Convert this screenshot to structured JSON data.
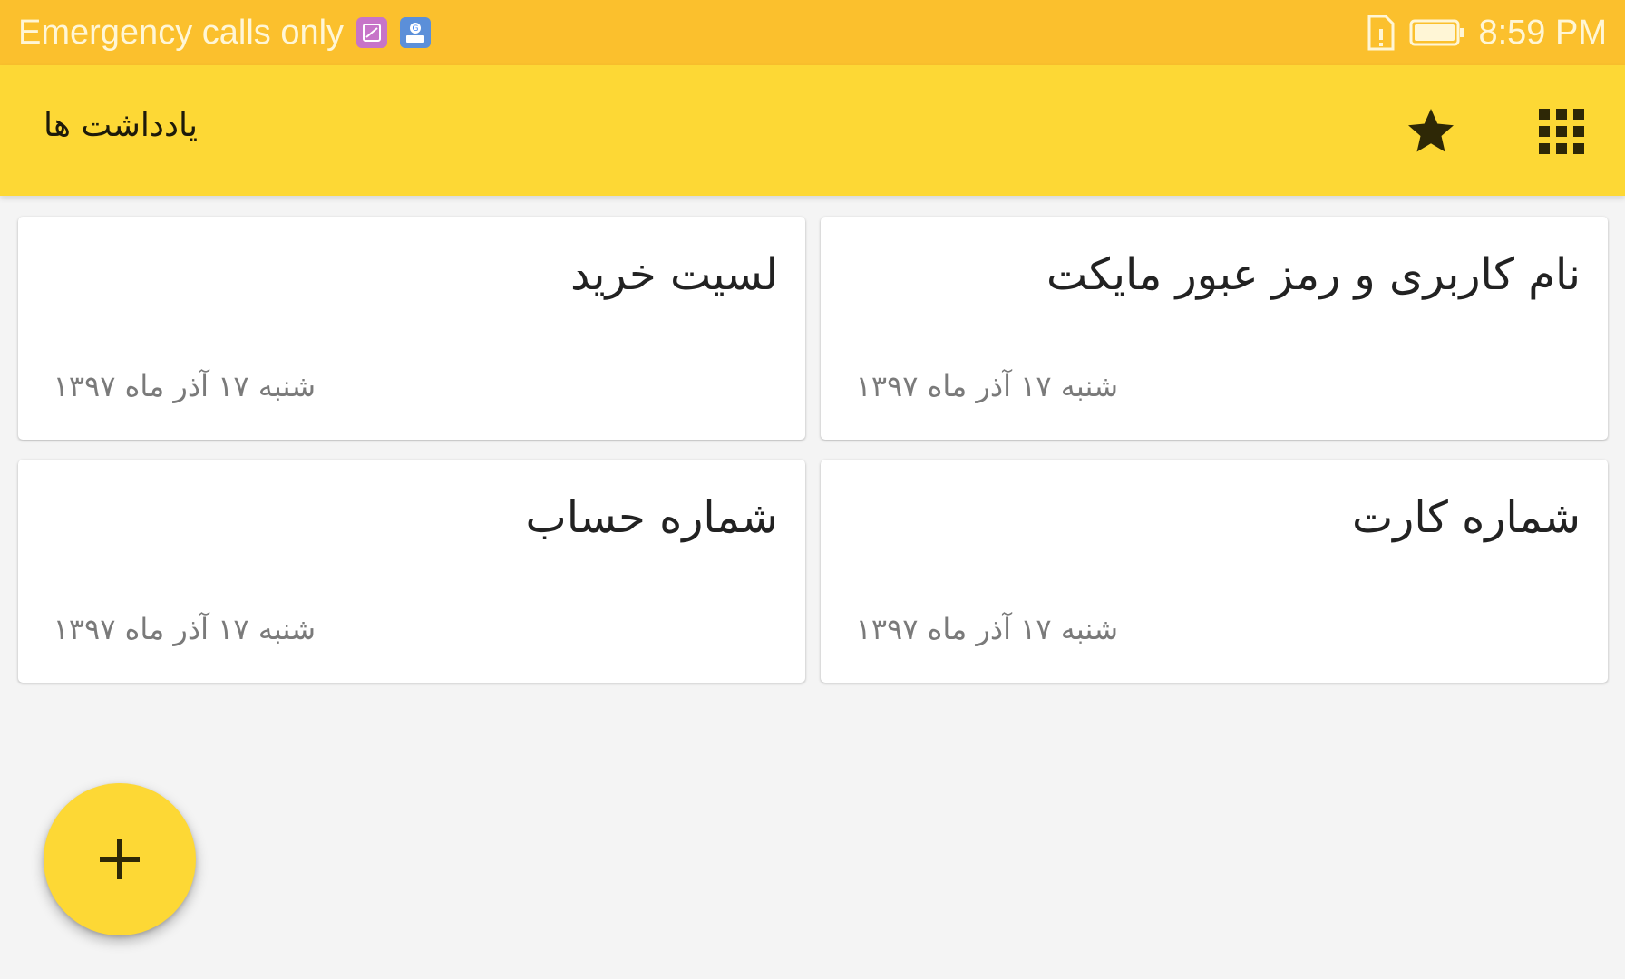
{
  "status_bar": {
    "carrier_text": "Emergency calls only",
    "time": "8:59 PM",
    "icons": [
      "gallery-notification-icon",
      "gboard-notification-icon",
      "sim-alert-icon",
      "battery-icon"
    ]
  },
  "app_bar": {
    "title": "یادداشت ها",
    "actions": [
      "star-icon",
      "grid-view-icon"
    ],
    "accent_color": "#fdd835",
    "status_color": "#fbc02d"
  },
  "notes": [
    {
      "title": "نام کاربری و رمز عبور مایکت",
      "date": "شنبه ۱۷ آذر ماه ۱۳۹۷"
    },
    {
      "title": "لسیت خرید",
      "date": "شنبه ۱۷ آذر ماه ۱۳۹۷"
    },
    {
      "title": "شماره کارت",
      "date": "شنبه ۱۷ آذر ماه ۱۳۹۷"
    },
    {
      "title": "شماره حساب",
      "date": "شنبه ۱۷ آذر ماه ۱۳۹۷"
    }
  ],
  "fab": {
    "icon": "plus-icon"
  }
}
